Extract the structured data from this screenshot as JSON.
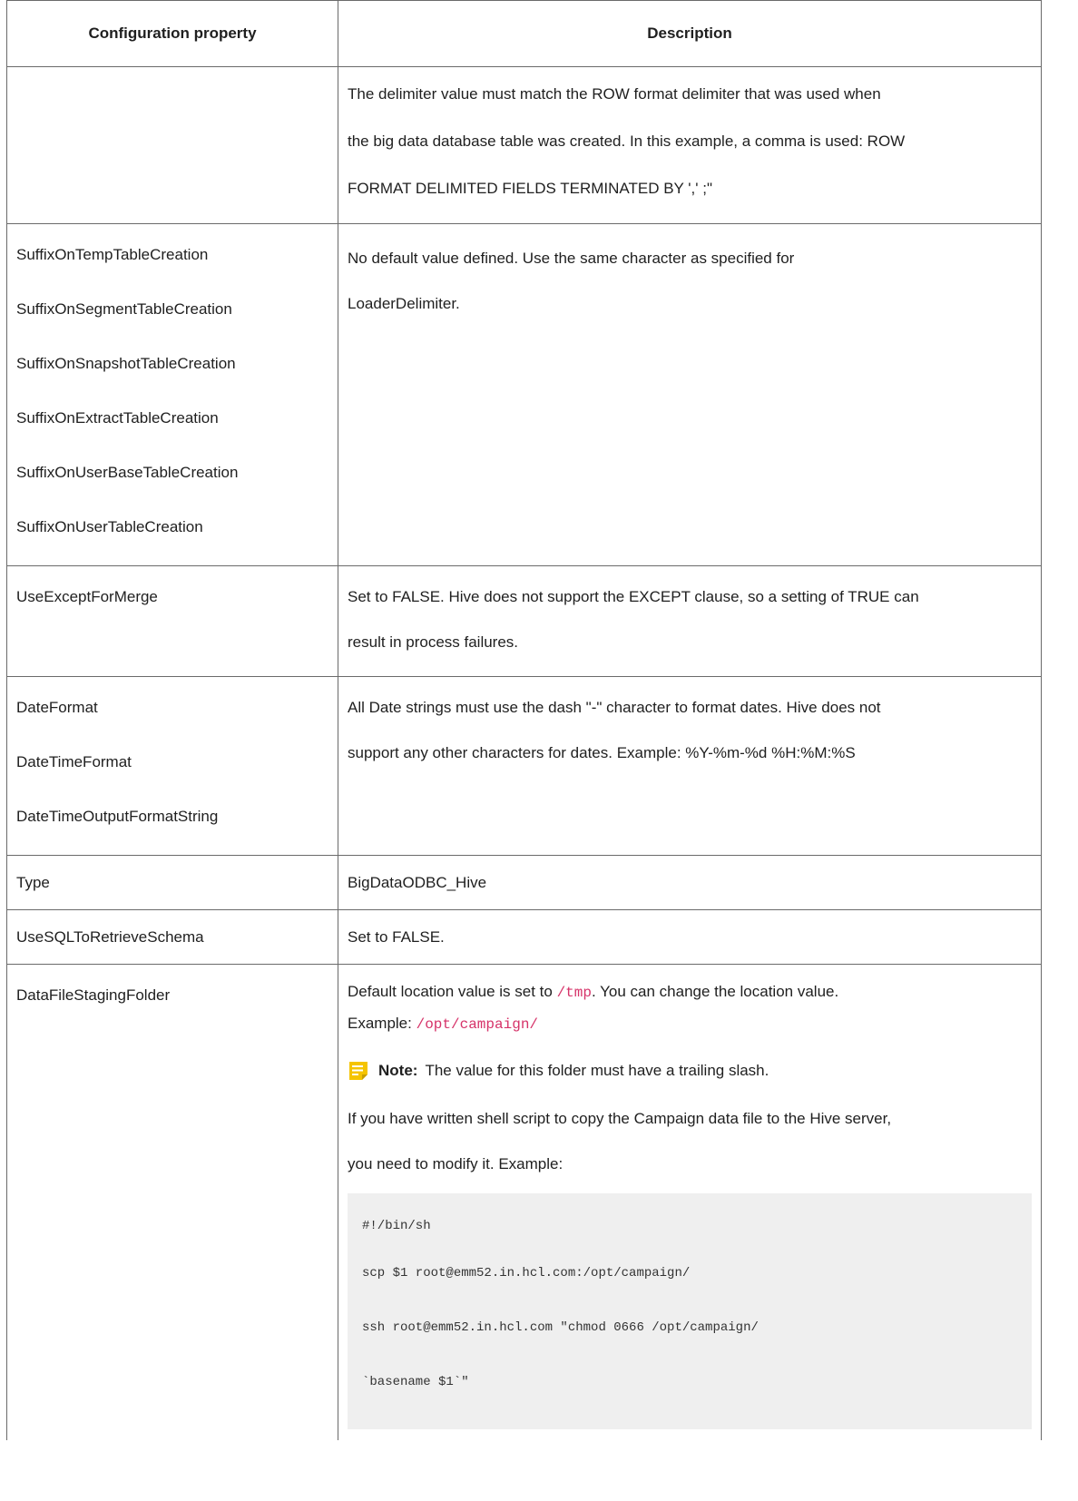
{
  "header": {
    "col1": "Configuration property",
    "col2": "Description"
  },
  "rows": [
    {
      "property": [],
      "description": [
        "The delimiter value must match the ROW format delimiter that was used when",
        "the big data database table was created. In this example, a comma is used: ROW",
        "FORMAT DELIMITED FIELDS TERMINATED BY ',' ;\""
      ]
    },
    {
      "property": [
        "SuffixOnTempTableCreation",
        "SuffixOnSegmentTableCreation",
        "SuffixOnSnapshotTableCreation",
        "SuffixOnExtractTableCreation",
        "SuffixOnUserBaseTableCreation",
        "SuffixOnUserTableCreation"
      ],
      "description": [
        "No default value defined. Use the same character as specified for",
        "LoaderDelimiter."
      ]
    },
    {
      "property": [
        "UseExceptForMerge"
      ],
      "description": [
        "Set to FALSE. Hive does not support the EXCEPT clause, so a setting of TRUE can",
        "result in process failures."
      ]
    },
    {
      "property": [
        "DateFormat",
        "DateTimeFormat",
        "DateTimeOutputFormatString"
      ],
      "description": [
        "All Date strings must use the dash \"-\" character to format dates. Hive does not",
        "support any other characters for dates. Example: %Y-%m-%d %H:%M:%S"
      ]
    },
    {
      "property": [
        "Type"
      ],
      "description": [
        "BigDataODBC_Hive"
      ]
    },
    {
      "property": [
        "UseSQLToRetrieveSchema"
      ],
      "description": [
        "Set to FALSE."
      ]
    }
  ],
  "staging": {
    "property": "DataFileStagingFolder",
    "default_prefix": "Default location value is set to ",
    "default_code": "/tmp",
    "default_suffix": ". You can change the location value.",
    "example_label": "Example: ",
    "example_code": "/opt/campaign/",
    "note_label": "Note:",
    "note_text": "The value for this folder must have a trailing slash.",
    "script_intro_1": "If you have written shell script to copy the Campaign data file to the Hive server,",
    "script_intro_2": "you need to modify it. Example:",
    "code_lines": [
      "#!/bin/sh",
      "scp $1 root@emm52.in.hcl.com:/opt/campaign/",
      "ssh root@emm52.in.hcl.com \"chmod 0666 /opt/campaign/",
      "`basename $1`\""
    ]
  },
  "colors": {
    "note_icon": "#f5c400",
    "inline_code": "#d63369",
    "code_bg": "#efefef",
    "border": "#6a6a6a"
  }
}
